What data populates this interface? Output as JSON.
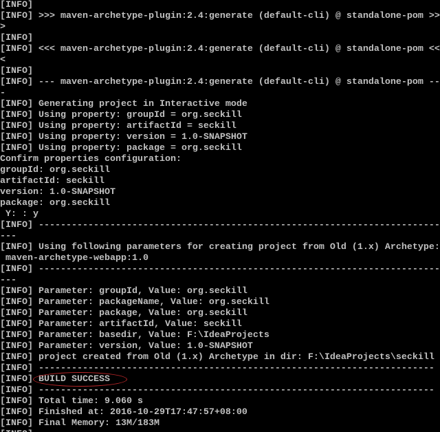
{
  "console": {
    "text_color": "#c0c0c0",
    "background": "#000000",
    "highlight_color": "#c0282a",
    "lines": [
      "[INFO]",
      "[INFO] >>> maven-archetype-plugin:2.4:generate (default-cli) @ standalone-pom >>",
      ">",
      "[INFO]",
      "[INFO] <<< maven-archetype-plugin:2.4:generate (default-cli) @ standalone-pom <<",
      "<",
      "[INFO]",
      "[INFO] --- maven-archetype-plugin:2.4:generate (default-cli) @ standalone-pom --",
      "-",
      "[INFO] Generating project in Interactive mode",
      "[INFO] Using property: groupId = org.seckill",
      "[INFO] Using property: artifactId = seckill",
      "[INFO] Using property: version = 1.0-SNAPSHOT",
      "[INFO] Using property: package = org.seckill",
      "Confirm properties configuration:",
      "groupId: org.seckill",
      "artifactId: seckill",
      "version: 1.0-SNAPSHOT",
      "package: org.seckill",
      " Y: : y",
      "[INFO] -------------------------------------------------------------------------",
      "---",
      "[INFO] Using following parameters for creating project from Old (1.x) Archetype:",
      " maven-archetype-webapp:1.0",
      "[INFO] -------------------------------------------------------------------------",
      "---",
      "[INFO] Parameter: groupId, Value: org.seckill",
      "[INFO] Parameter: packageName, Value: org.seckill",
      "[INFO] Parameter: package, Value: org.seckill",
      "[INFO] Parameter: artifactId, Value: seckill",
      "[INFO] Parameter: basedir, Value: F:\\IdeaProjects",
      "[INFO] Parameter: version, Value: 1.0-SNAPSHOT",
      "[INFO] project created from Old (1.x) Archetype in dir: F:\\IdeaProjects\\seckill",
      "[INFO] ------------------------------------------------------------------------",
      "[INFO] BUILD SUCCESS",
      "[INFO] ------------------------------------------------------------------------",
      "[INFO] Total time: 9.060 s",
      "[INFO] Finished at: 2016-10-29T17:47:57+08:00",
      "[INFO] Final Memory: 13M/183M",
      "[INFO]"
    ]
  }
}
